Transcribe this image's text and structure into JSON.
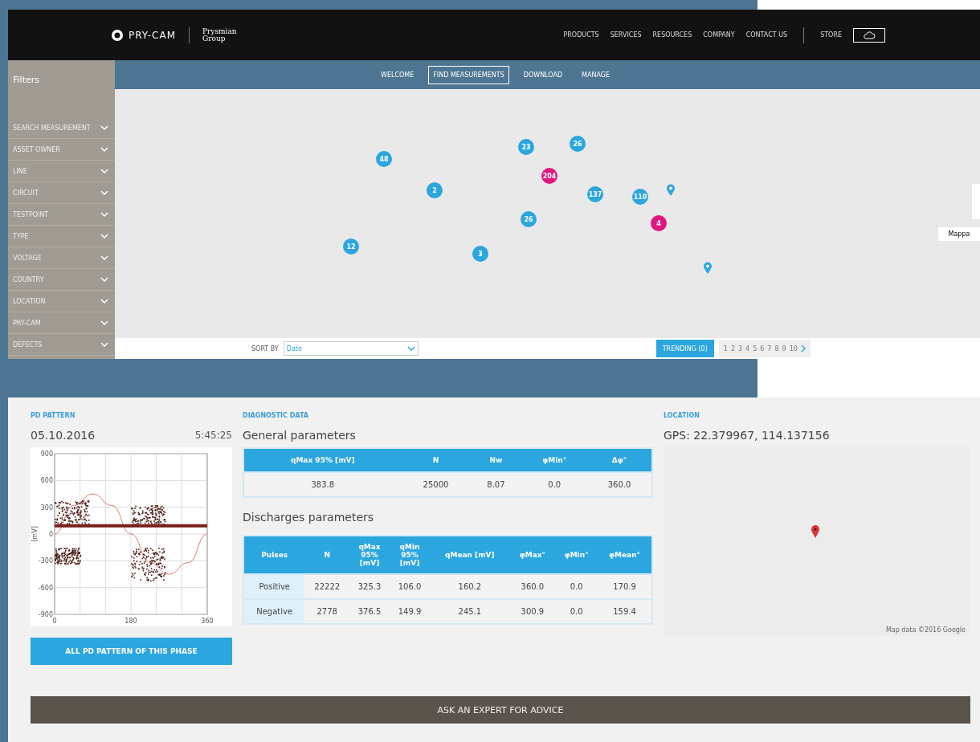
{
  "header": {
    "logo": "PRY-CAM",
    "partner": "Prysmian",
    "partner_sub": "Group",
    "nav": [
      "PRODUCTS",
      "SERVICES",
      "RESOURCES",
      "COMPANY",
      "CONTACT US"
    ],
    "store": "STORE"
  },
  "tabs": [
    {
      "label": "WELCOME",
      "selected": false
    },
    {
      "label": "FIND MEASUREMENTS",
      "selected": true
    },
    {
      "label": "DOWNLOAD",
      "selected": false
    },
    {
      "label": "MANAGE",
      "selected": false
    }
  ],
  "filters": {
    "title": "Filters",
    "items": [
      {
        "label": "SEARCH MEASUREMENT",
        "expanded": false
      },
      {
        "label": "ASSET OWNER",
        "expanded": false
      },
      {
        "label": "LINE",
        "expanded": false
      },
      {
        "label": "CIRCUIT",
        "expanded": false
      },
      {
        "label": "TESTPOINT",
        "expanded": false
      },
      {
        "label": "TYPE",
        "expanded": false
      },
      {
        "label": "VOLTAGE",
        "expanded": false
      },
      {
        "label": "COUNTRY",
        "expanded": false
      },
      {
        "label": "LOCATION",
        "expanded": false
      },
      {
        "label": "PRY-CAM",
        "expanded": false
      },
      {
        "label": "DEFECTS",
        "expanded": false
      }
    ]
  },
  "map": {
    "map_type": "Mappa",
    "clusters": [
      {
        "count": "48",
        "color": "#2ba6de"
      },
      {
        "count": "2",
        "color": "#2ba6de"
      },
      {
        "count": "23",
        "color": "#2ba6de"
      },
      {
        "count": "26",
        "color": "#2ba6de"
      },
      {
        "count": "204",
        "color": "#e0157f"
      },
      {
        "count": "137",
        "color": "#2ba6de"
      },
      {
        "count": "110",
        "color": "#2ba6de"
      },
      {
        "count": "26",
        "color": "#2ba6de"
      },
      {
        "count": "12",
        "color": "#2ba6de"
      },
      {
        "count": "3",
        "color": "#2ba6de"
      },
      {
        "count": "4",
        "color": "#e0157f"
      }
    ]
  },
  "sort": {
    "label": "SORT BY",
    "value": "Date"
  },
  "trending": "TRENDING (0)",
  "pages": [
    "1",
    "2",
    "3",
    "4",
    "5",
    "6",
    "7",
    "8",
    "9",
    "10"
  ],
  "pd_pattern": {
    "section": "PD PATTERN",
    "date": "05.10.2016",
    "time": "5:45:25",
    "chart_data": {
      "type": "line",
      "ylabel": "[mV]",
      "x": [
        0,
        45,
        90,
        135,
        180,
        225,
        270,
        315,
        360
      ],
      "series": [
        {
          "color": "#e07a70",
          "values": [
            0,
            320,
            450,
            320,
            0,
            -320,
            -450,
            -320,
            0
          ]
        }
      ],
      "grid": true,
      "xlim": [
        0,
        360
      ],
      "ylim": [
        -900,
        900
      ],
      "xticks": [
        0,
        180,
        360
      ],
      "yticks": [
        900,
        600,
        300,
        0,
        -300,
        -600,
        -900
      ]
    },
    "button": "ALL PD PATTERN OF THIS PHASE"
  },
  "diagnostic": {
    "section": "DIAGNOSTIC DATA",
    "general_title": "General parameters",
    "general_columns": [
      "qMax 95% [mV]",
      "N",
      "Nw",
      "φMin°",
      "Δφ°"
    ],
    "general_row": [
      "383.8",
      "25000",
      "8.07",
      "0.0",
      "360.0"
    ],
    "discharges_title": "Discharges parameters",
    "discharges_columns": [
      "Pulses",
      "N",
      "qMax 95% [mV]",
      "qMin 95% [mV]",
      "qMean [mV]",
      "φMax°",
      "φMin°",
      "φMean°"
    ],
    "discharges_rows": [
      [
        "Positive",
        "22222",
        "325.3",
        "106.0",
        "160.2",
        "360.0",
        "0.0",
        "170.9"
      ],
      [
        "Negative",
        "2778",
        "376.5",
        "149.9",
        "245.1",
        "300.9",
        "0.0",
        "159.4"
      ]
    ]
  },
  "location": {
    "section": "LOCATION",
    "gps": "GPS: 22.379967, 114.137156",
    "attribution": "Map data ©2016 Google"
  },
  "advice_button": "ASK AN EXPERT FOR ADVICE"
}
